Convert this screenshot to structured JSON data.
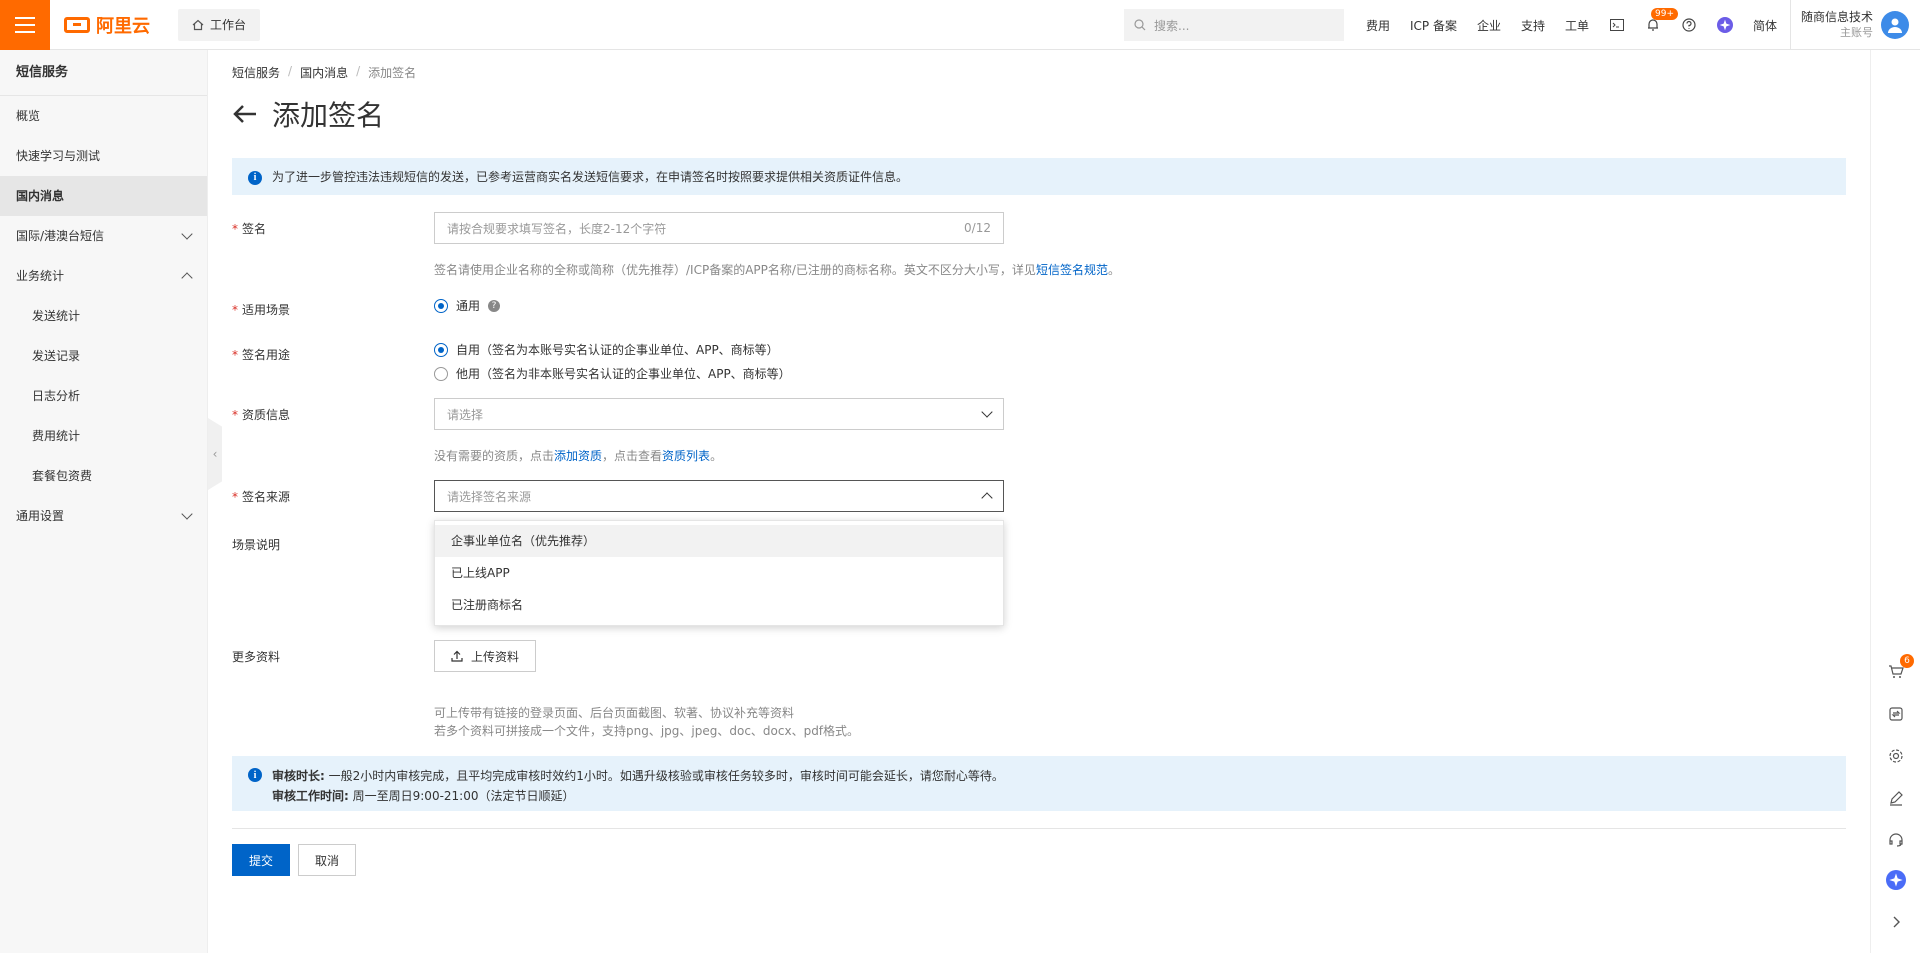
{
  "header": {
    "brand": "阿里云",
    "workbench": "工作台",
    "search_placeholder": "搜索...",
    "nav": [
      "费用",
      "ICP 备案",
      "企业",
      "支持",
      "工单"
    ],
    "notification_badge": "99+",
    "language": "简体",
    "user_name": "随商信息技术",
    "user_role": "主账号"
  },
  "sidebar": {
    "title": "短信服务",
    "items": [
      {
        "label": "概览"
      },
      {
        "label": "快速学习与测试"
      },
      {
        "label": "国内消息"
      },
      {
        "label": "国际/港澳台短信"
      },
      {
        "label": "业务统计"
      },
      {
        "label": "发送统计"
      },
      {
        "label": "发送记录"
      },
      {
        "label": "日志分析"
      },
      {
        "label": "费用统计"
      },
      {
        "label": "套餐包资费"
      },
      {
        "label": "通用设置"
      }
    ]
  },
  "breadcrumb": [
    "短信服务",
    "国内消息",
    "添加签名"
  ],
  "page_title": "添加签名",
  "notice_top": "为了进一步管控违法违规短信的发送，已参考运营商实名发送短信要求，在申请签名时按照要求提供相关资质证件信息。",
  "form": {
    "signature": {
      "label": "签名",
      "placeholder": "请按合规要求填写签名，长度2-12个字符",
      "counter": "0/12",
      "help_prefix": "签名请使用企业名称的全称或简称（优先推荐）/ICP备案的APP名称/已注册的商标名称。英文不区分大小写，详见",
      "help_link": "短信签名规范",
      "help_suffix": "。"
    },
    "scene": {
      "label": "适用场景",
      "option": "通用",
      "help_icon": "?"
    },
    "usage": {
      "label": "签名用途",
      "option_self": "自用（签名为本账号实名认证的企事业单位、APP、商标等）",
      "option_other": "他用（签名为非本账号实名认证的企事业单位、APP、商标等）"
    },
    "qualification": {
      "label": "资质信息",
      "placeholder": "请选择",
      "help_prefix": "没有需要的资质，点击",
      "help_link1": "添加资质",
      "help_mid": "，点击查看",
      "help_link2": "资质列表",
      "help_suffix": "。"
    },
    "source": {
      "label": "签名来源",
      "placeholder": "请选择签名来源",
      "options": [
        "企事业单位名（优先推荐）",
        "已上线APP",
        "已注册商标名"
      ]
    },
    "scene_desc": {
      "label": "场景说明"
    },
    "more": {
      "label": "更多资料",
      "upload": "上传资料",
      "help1": "可上传带有链接的登录页面、后台页面截图、软著、协议补充等资料",
      "help2": "若多个资料可拼接成一个文件，支持png、jpg、jpeg、doc、docx、pdf格式。"
    }
  },
  "notice_bottom": {
    "title1": "审核时长:",
    "text1": " 一般2小时内审核完成，且平均完成审核时效约1小时。如遇升级核验或审核任务较多时，审核时间可能会延长，请您耐心等待。",
    "title2": "审核工作时间:",
    "text2": " 周一至周日9:00-21:00（法定节日顺延）"
  },
  "actions": {
    "submit": "提交",
    "cancel": "取消"
  },
  "rail": {
    "cart_badge": "6"
  },
  "colors": {
    "brand": "#ff6a00",
    "primary": "#0064c8",
    "notice_bg": "#e6f2fb"
  }
}
